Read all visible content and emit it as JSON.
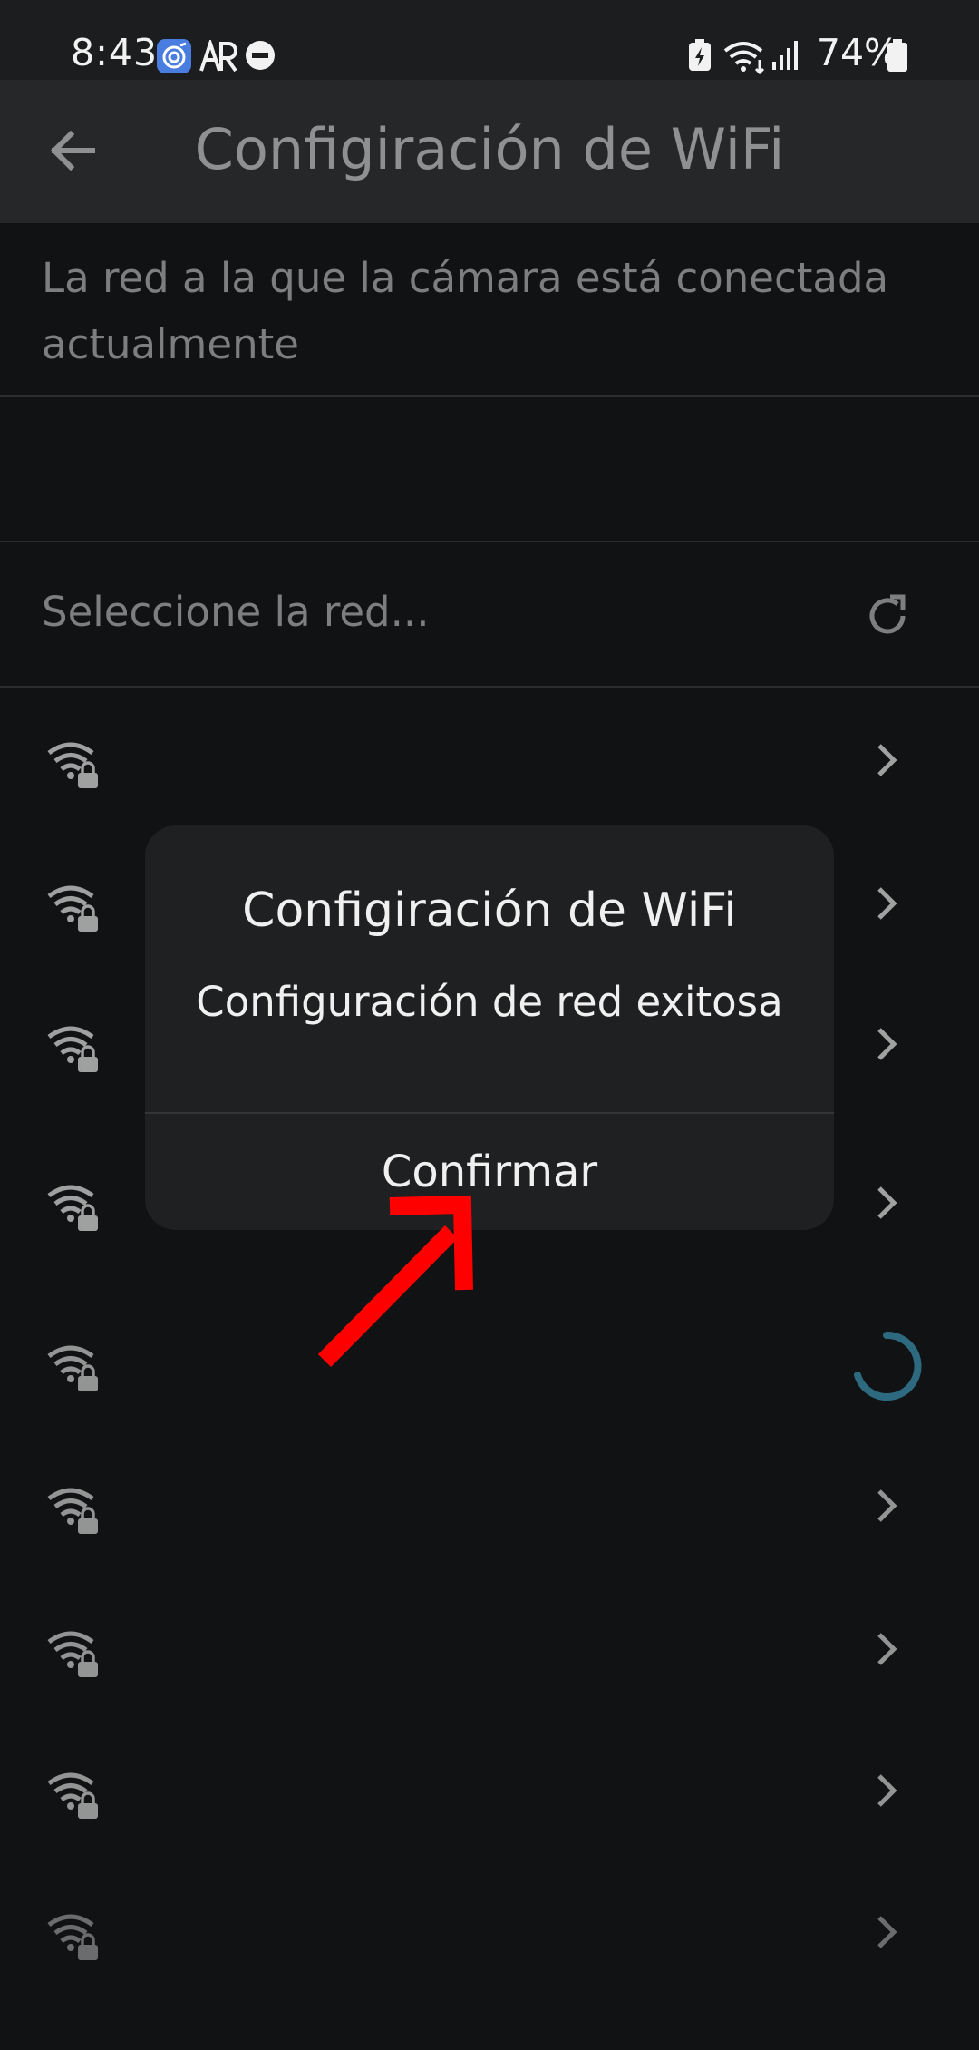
{
  "status_bar": {
    "time": "8:43",
    "battery": "74%",
    "icons": [
      "app-notification-icon",
      "ar-icon",
      "do-not-disturb-icon",
      "battery-saver-icon",
      "wifi-icon",
      "signal-icon",
      "battery-icon"
    ]
  },
  "app_bar": {
    "title": "Configiración de WiFi",
    "back_icon": "back-arrow-icon"
  },
  "current_network": {
    "header": "La red a la que la cámara está conectada actualmente",
    "name": ""
  },
  "network_select": {
    "label": "Seleccione la red...",
    "refresh_icon": "refresh-icon"
  },
  "networks": [
    {
      "name": "",
      "icon": "wifi-lock-icon"
    },
    {
      "name": "",
      "icon": "wifi-lock-icon"
    },
    {
      "name": "",
      "icon": "wifi-lock-icon"
    },
    {
      "name": "",
      "icon": "wifi-lock-icon"
    },
    {
      "name": "",
      "icon": "wifi-lock-icon",
      "loading": true
    },
    {
      "name": "",
      "icon": "wifi-lock-icon"
    },
    {
      "name": "",
      "icon": "wifi-lock-icon"
    },
    {
      "name": "",
      "icon": "wifi-lock-icon"
    },
    {
      "name": "",
      "icon": "wifi-lock-icon"
    }
  ],
  "dialog": {
    "title": "Configiración de WiFi",
    "message": "Configuración de red exitosa",
    "confirm_label": "Confirmar"
  },
  "colors": {
    "background": "#101213",
    "app_bar": "#252728",
    "dialog": "#1f2021",
    "spinner": "#2d6a80",
    "annotation_arrow": "#ff0000"
  }
}
